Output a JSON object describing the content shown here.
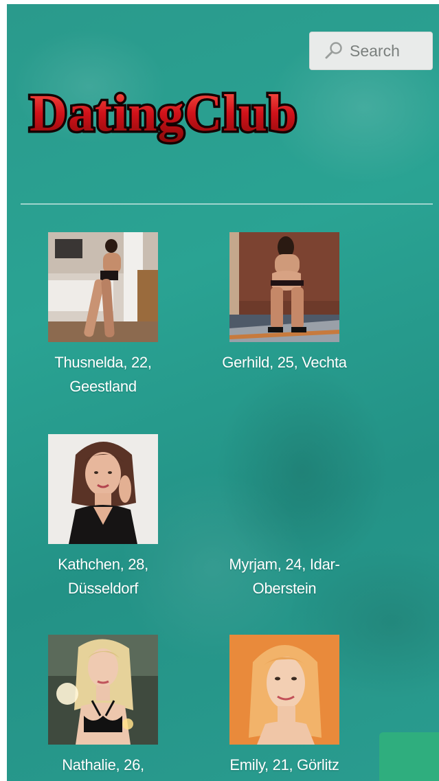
{
  "search": {
    "label": "Search",
    "icon": "search-icon"
  },
  "logo": {
    "text": "DatingClub"
  },
  "profiles": [
    {
      "name": "Thusnelda, 22, Geestland"
    },
    {
      "name": "Gerhild, 25, Vechta"
    },
    {
      "name": "Kathchen, 28, Düsseldorf"
    },
    {
      "name": "Myrjam, 24, Idar-Oberstein"
    },
    {
      "name": "Nathalie, 26,"
    },
    {
      "name": "Emily, 21, Görlitz"
    }
  ],
  "colors": {
    "background": "#2aa393",
    "logo_fill": "#d01a1a",
    "logo_outline": "#1a0505"
  }
}
